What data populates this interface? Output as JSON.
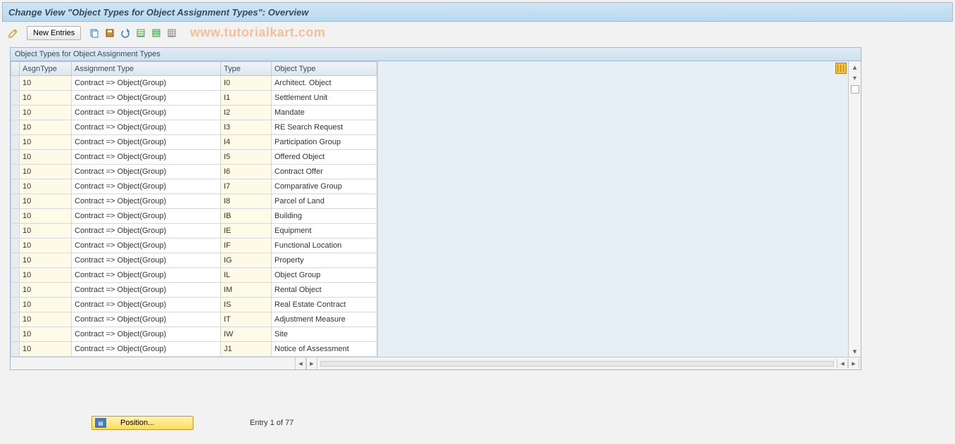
{
  "header": {
    "title": "Change View \"Object Types for Object Assignment Types\": Overview",
    "panel_title": "Object Types for Object Assignment Types"
  },
  "toolbar": {
    "new_entries_label": "New Entries"
  },
  "watermark": "www.tutorialkart.com",
  "columns": {
    "asgn_type": "AsgnType",
    "assignment_type": "Assignment Type",
    "type": "Type",
    "object_type": "Object Type"
  },
  "rows": [
    {
      "asgn": "10",
      "atype": "Contract => Object(Group)",
      "type": "I0",
      "obj": "Architect. Object"
    },
    {
      "asgn": "10",
      "atype": "Contract => Object(Group)",
      "type": "I1",
      "obj": "Settlement Unit"
    },
    {
      "asgn": "10",
      "atype": "Contract => Object(Group)",
      "type": "I2",
      "obj": "Mandate"
    },
    {
      "asgn": "10",
      "atype": "Contract => Object(Group)",
      "type": "I3",
      "obj": "RE Search Request"
    },
    {
      "asgn": "10",
      "atype": "Contract => Object(Group)",
      "type": "I4",
      "obj": "Participation Group"
    },
    {
      "asgn": "10",
      "atype": "Contract => Object(Group)",
      "type": "I5",
      "obj": "Offered Object"
    },
    {
      "asgn": "10",
      "atype": "Contract => Object(Group)",
      "type": "I6",
      "obj": "Contract Offer"
    },
    {
      "asgn": "10",
      "atype": "Contract => Object(Group)",
      "type": "I7",
      "obj": "Comparative Group"
    },
    {
      "asgn": "10",
      "atype": "Contract => Object(Group)",
      "type": "I8",
      "obj": "Parcel of Land"
    },
    {
      "asgn": "10",
      "atype": "Contract => Object(Group)",
      "type": "IB",
      "obj": "Building"
    },
    {
      "asgn": "10",
      "atype": "Contract => Object(Group)",
      "type": "IE",
      "obj": "Equipment"
    },
    {
      "asgn": "10",
      "atype": "Contract => Object(Group)",
      "type": "IF",
      "obj": "Functional Location"
    },
    {
      "asgn": "10",
      "atype": "Contract => Object(Group)",
      "type": "IG",
      "obj": "Property"
    },
    {
      "asgn": "10",
      "atype": "Contract => Object(Group)",
      "type": "IL",
      "obj": "Object Group"
    },
    {
      "asgn": "10",
      "atype": "Contract => Object(Group)",
      "type": "IM",
      "obj": "Rental Object"
    },
    {
      "asgn": "10",
      "atype": "Contract => Object(Group)",
      "type": "IS",
      "obj": "Real Estate Contract"
    },
    {
      "asgn": "10",
      "atype": "Contract => Object(Group)",
      "type": "IT",
      "obj": "Adjustment Measure"
    },
    {
      "asgn": "10",
      "atype": "Contract => Object(Group)",
      "type": "IW",
      "obj": "Site"
    },
    {
      "asgn": "10",
      "atype": "Contract => Object(Group)",
      "type": "J1",
      "obj": "Notice of Assessment"
    }
  ],
  "footer": {
    "position_label": "Position...",
    "entry_label": "Entry 1 of 77"
  }
}
